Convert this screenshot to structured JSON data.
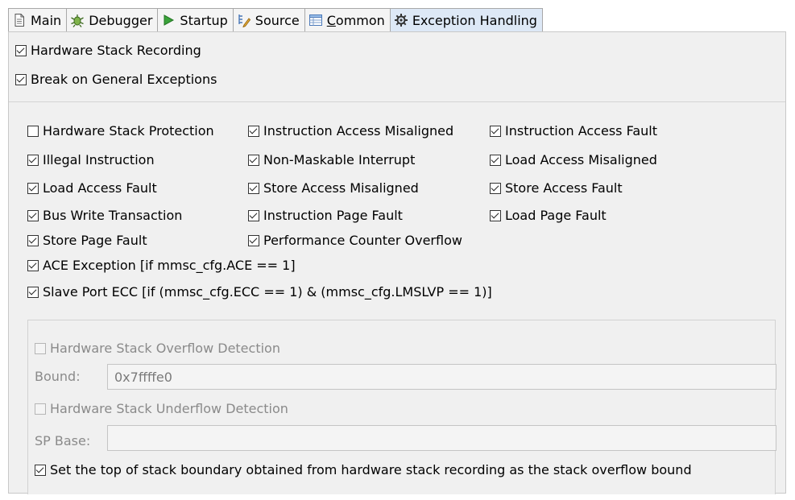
{
  "tabs": [
    {
      "label": "Main",
      "icon": "document-icon"
    },
    {
      "label": "Debugger",
      "icon": "bug-icon"
    },
    {
      "label": "Startup",
      "icon": "play-icon"
    },
    {
      "label": "Source",
      "icon": "source-icon"
    },
    {
      "label": "Common",
      "icon": "table-icon",
      "mnemonic": "C"
    },
    {
      "label": "Exception Handling",
      "icon": "gear-icon"
    }
  ],
  "tabs_common_rest": "ommon",
  "top_options": [
    {
      "label": "Hardware Stack Recording",
      "checked": true
    },
    {
      "label": "Break on General Exceptions",
      "checked": true
    }
  ],
  "exceptions": [
    {
      "label": "Hardware Stack Protection",
      "checked": false
    },
    {
      "label": "Instruction Access Misaligned",
      "checked": true
    },
    {
      "label": "Instruction Access Fault",
      "checked": true
    },
    {
      "label": "Illegal Instruction",
      "checked": true
    },
    {
      "label": "Non-Maskable Interrupt",
      "checked": true
    },
    {
      "label": "Load Access Misaligned",
      "checked": true
    },
    {
      "label": "Load Access Fault",
      "checked": true
    },
    {
      "label": "Store Access Misaligned",
      "checked": true
    },
    {
      "label": "Store Access Fault",
      "checked": true
    },
    {
      "label": "Bus Write Transaction",
      "checked": true
    },
    {
      "label": "Instruction Page Fault",
      "checked": true
    },
    {
      "label": "Load Page Fault",
      "checked": true
    },
    {
      "label": "Store Page Fault",
      "checked": true
    },
    {
      "label": "Performance Counter Overflow",
      "checked": true
    },
    {
      "label": "ACE Exception [if mmsc_cfg.ACE == 1]",
      "checked": true
    },
    {
      "label": "Slave Port ECC [if (mmsc_cfg.ECC == 1) & (mmsc_cfg.LMSLVP == 1)]",
      "checked": true
    }
  ],
  "stack": {
    "overflow_label": "Hardware Stack Overflow Detection",
    "overflow_checked": false,
    "bound_label": "Bound:",
    "bound_value": "0x7ffffe0",
    "underflow_label": "Hardware Stack Underflow Detection",
    "underflow_checked": false,
    "sp_base_label": "SP Base:",
    "sp_base_value": "",
    "set_top_label": "Set the top of stack boundary obtained from hardware stack recording as the stack overflow bound",
    "set_top_checked": true
  },
  "colors": {
    "active_tab": "#dde8f6",
    "panel_bg": "#f0f0f0",
    "disabled_text": "#8a8a8a"
  }
}
